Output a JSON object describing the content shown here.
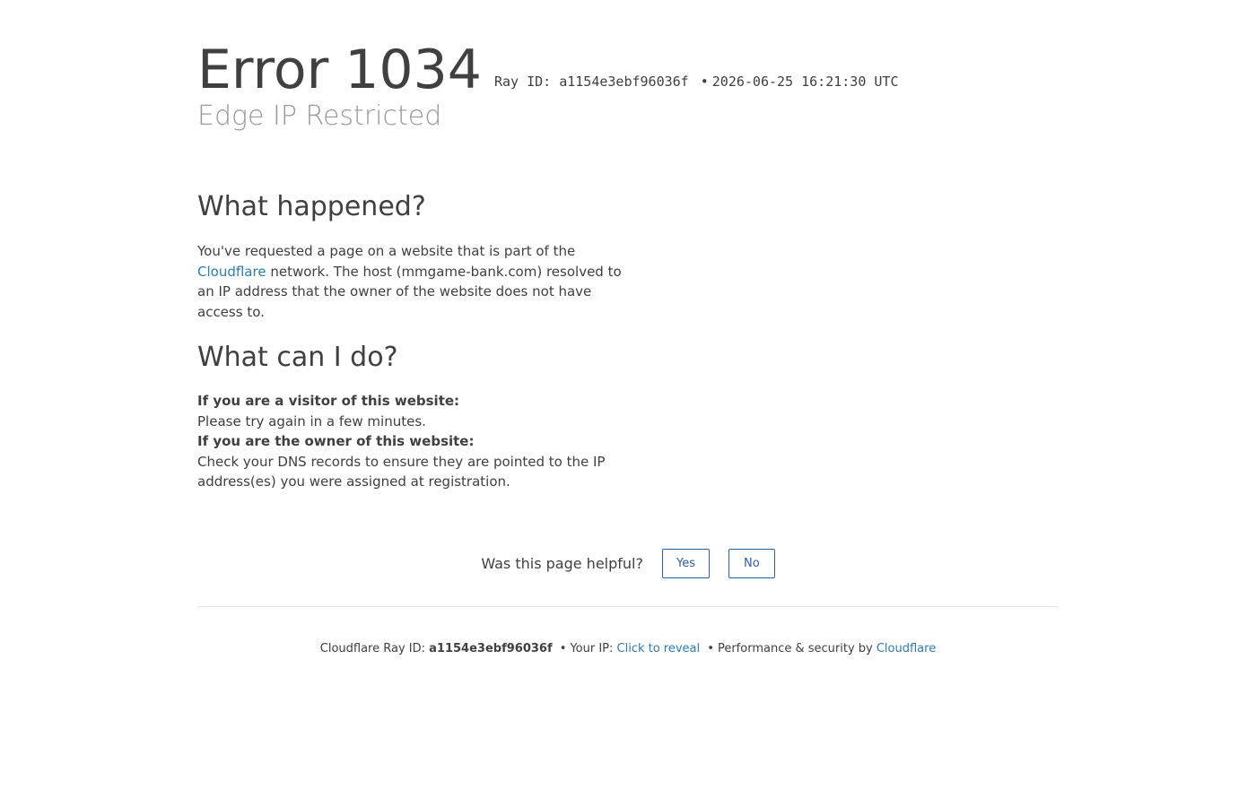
{
  "header": {
    "error_word": "Error",
    "error_code": "1034",
    "ray_id_label": "Ray ID: a1154e3ebf96036f",
    "separator": "•",
    "timestamp": "2026-06-25 16:21:30 UTC",
    "subtitle": "Edge IP Restricted"
  },
  "what_happened": {
    "heading": "What happened?",
    "text_before_link": "You've requested a page on a website that is part of the ",
    "link_text": "Cloudflare",
    "text_after_link": " network. The host (mmgame-bank.com) resolved to an IP address that the owner of the website does not have access to."
  },
  "what_can_i_do": {
    "heading": "What can I do?",
    "visitor_label": "If you are a visitor of this website:",
    "visitor_text": "Please try again in a few minutes.",
    "owner_label": "If you are the owner of this website:",
    "owner_text": "Check your DNS records to ensure they are pointed to the IP address(es) you were assigned at registration."
  },
  "feedback": {
    "question": "Was this page helpful?",
    "yes_label": "Yes",
    "no_label": "No"
  },
  "footer": {
    "ray_label": "Cloudflare Ray ID: ",
    "ray_id": "a1154e3ebf96036f",
    "sep": "•",
    "ip_label": "Your IP: ",
    "ip_link": "Click to reveal",
    "perf_label": "Performance & security by ",
    "brand_link": "Cloudflare"
  },
  "colors": {
    "text": "#404040",
    "subtitle": "#999999",
    "link": "#2c7cb0",
    "button": "#2f5ea3"
  }
}
